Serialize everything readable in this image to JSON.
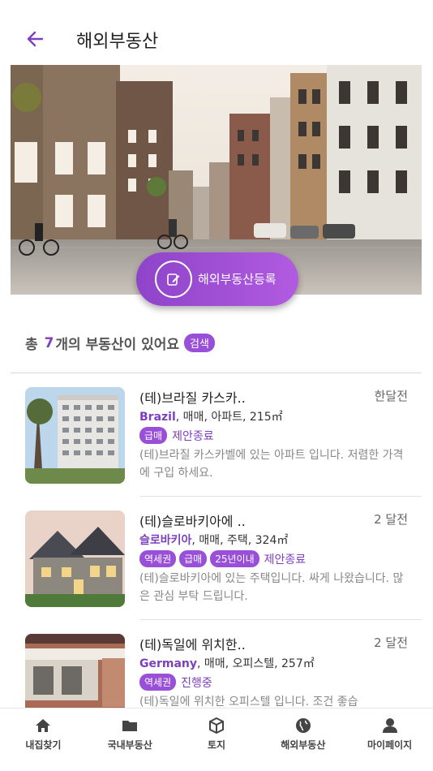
{
  "header": {
    "back_icon": "back-arrow-icon",
    "title": "해외부동산"
  },
  "banner": {
    "image": "european-street-photo",
    "register_label": "해외부동산등록",
    "register_icon": "edit-icon"
  },
  "summary": {
    "prefix": "총",
    "count": "7",
    "suffix": "개의 부동산이 있어요",
    "search_label": "검색"
  },
  "listings": [
    {
      "title": "(테)브라질 카스카..",
      "time": "한달전",
      "country": "Brazil",
      "details": ", 매매, 아파트, 215㎡",
      "tags": [
        "급매"
      ],
      "status": "제안종료",
      "description": "(테)브라질 카스카벨에 있는 아파트 입니다. 저렴한 가격에 구입 하세요."
    },
    {
      "title": "(테)슬로바키아에 ..",
      "time": "2 달전",
      "country": "슬로바키아",
      "details": ", 매매, 주택, 324㎡",
      "tags": [
        "역세권",
        "급매",
        "25년이내"
      ],
      "status": "제안종료",
      "description": "(테)슬로바키아에 있는 주택입니다. 싸게 나왔습니다. 많은 관심 부탁 드립니다."
    },
    {
      "title": "(테)독일에 위치한..",
      "time": "2 달전",
      "country": "Germany",
      "details": ", 매매, 오피스텔, 257㎡",
      "tags": [
        "역세권"
      ],
      "status": "진행중",
      "description": "(테)독일에 위치한 오피스텔 입니다. 조건 좋습"
    }
  ],
  "nav": [
    {
      "label": "내집찾기",
      "icon": "home-icon"
    },
    {
      "label": "국내부동산",
      "icon": "folder-icon"
    },
    {
      "label": "토지",
      "icon": "cube-icon"
    },
    {
      "label": "해외부동산",
      "icon": "globe-icon"
    },
    {
      "label": "마이페이지",
      "icon": "person-icon"
    }
  ],
  "colors": {
    "accent": "#7e3fbf",
    "chip": "#9a4fd9"
  }
}
